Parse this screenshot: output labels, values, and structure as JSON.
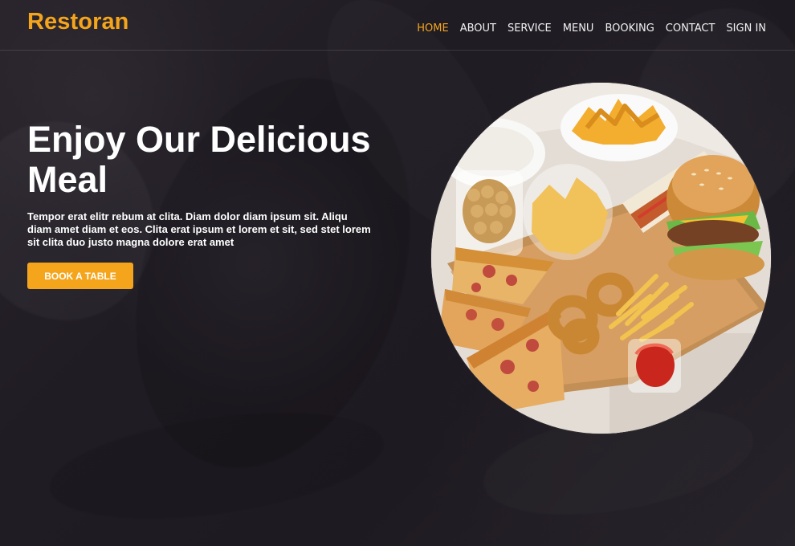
{
  "brand": {
    "name": "Restoran"
  },
  "nav": {
    "items": [
      {
        "label": "HOME"
      },
      {
        "label": "ABOUT"
      },
      {
        "label": "SERVICE"
      },
      {
        "label": "MENU"
      },
      {
        "label": "BOOKING"
      },
      {
        "label": "CONTACT"
      },
      {
        "label": "SIGN IN"
      }
    ],
    "active_index": 0
  },
  "hero": {
    "title": "Enjoy Our Delicious Meal",
    "description": "Tempor erat elitr rebum at clita. Diam dolor diam ipsum sit. Aliqu diam amet diam et eos. Clita erat ipsum et lorem et sit, sed stet lorem sit clita duo justo magna dolore erat amet",
    "button_label": "BOOK A TABLE"
  },
  "theme": {
    "accent": "#f4a51c",
    "background": "#1e1b22",
    "text": "#ffffff"
  }
}
